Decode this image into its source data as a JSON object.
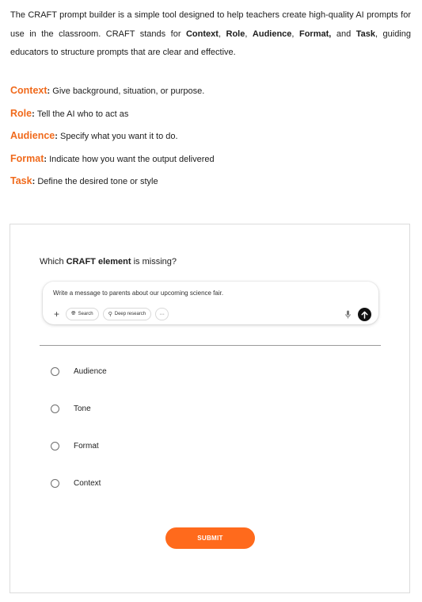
{
  "colors": {
    "accent": "#ff6a1c",
    "term": "#f06a1c",
    "text": "#1d1d1d"
  },
  "intro": {
    "t1": "The CRAFT prompt builder is a simple tool designed to help teachers create high-quality AI prompts for use in the classroom. CRAFT stands for ",
    "b1": "Context",
    "s1": ", ",
    "b2": "Role",
    "s2": ", ",
    "b3": "Audience",
    "s3": ", ",
    "b4": "Format,",
    "s4": " and ",
    "b5": "Task",
    "t2": ", guiding educators to structure prompts that are clear and effective."
  },
  "legend": [
    {
      "term": "Context",
      "desc": "Give background, situation, or purpose."
    },
    {
      "term": "Role",
      "desc": "Tell the AI who to act as"
    },
    {
      "term": "Audience",
      "desc": "Specify what you want it to do."
    },
    {
      "term": "Format",
      "desc": "Indicate how you want the output delivered"
    },
    {
      "term": "Task",
      "desc": "Define the desired tone or style"
    }
  ],
  "quiz": {
    "question_pre": "Which ",
    "question_bold": "CRAFT element",
    "question_post": " is missing?",
    "prompt": {
      "text": "Write a message to parents about our upcoming science fair.",
      "plus_icon": "plus-icon",
      "search_label": "Search",
      "deep_research_label": "Deep research",
      "more_icon": "ellipsis-icon",
      "mic_icon": "microphone-icon",
      "send_icon": "arrow-up-icon"
    },
    "options": [
      "Audience",
      "Tone",
      "Format",
      "Context"
    ],
    "submit_label": "SUBMIT"
  }
}
